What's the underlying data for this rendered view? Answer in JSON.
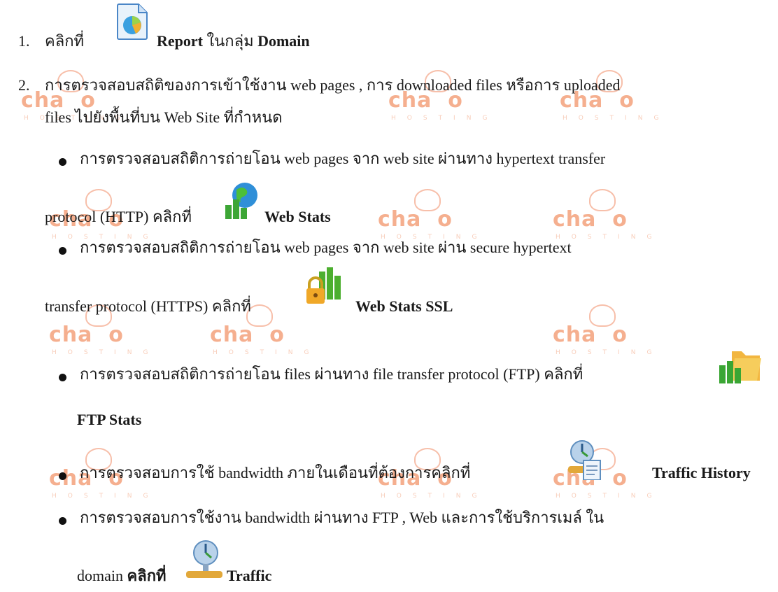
{
  "items": [
    {
      "num": "1.",
      "pre": "คลิกที่",
      "bold1": "Report",
      "mid": "ในกลุ่ม",
      "bold2": "Domain"
    },
    {
      "num": "2.",
      "line1": "การตรวจสอบสถิติของการเข้าใช้งาน web pages  , การ downloaded files หรือการ uploaded",
      "line2": "files ไปยังพื้นที่บน Web Site ที่กำหนด"
    }
  ],
  "bullets": [
    {
      "line1": "การตรวจสอบสถิติการถ่ายโอน web pages จาก web site ผ่านทาง hypertext transfer",
      "line2_pre": "protocol (HTTP)   คลิกที่",
      "label": "Web Stats"
    },
    {
      "line1": "การตรวจสอบสถิติการถ่ายโอน web pages จาก web site ผ่าน secure hypertext",
      "line2_pre": "transfer protocol (HTTPS)   คลิกที่",
      "label": "Web Stats SSL"
    },
    {
      "line1": "การตรวจสอบสถิติการถ่ายโอน files ผ่านทาง file transfer protocol (FTP) คลิกที่",
      "label": "FTP Stats"
    },
    {
      "line1": "การตรวจสอบการใช้ bandwidth ภายในเดือนที่ต้องการคลิกที่",
      "label": "Traffic History"
    },
    {
      "line1": "การตรวจสอบการใช้งาน bandwidth ผ่านทาง  FTP , Web และการใช้บริการเมล์ ใน",
      "line2_pre": "domain",
      "line2_bold": "คลิกที่",
      "label": "Traffic"
    }
  ],
  "watermark": {
    "word": "chai",
    "sub": "HOSTING",
    "color": "#f4a27c"
  }
}
